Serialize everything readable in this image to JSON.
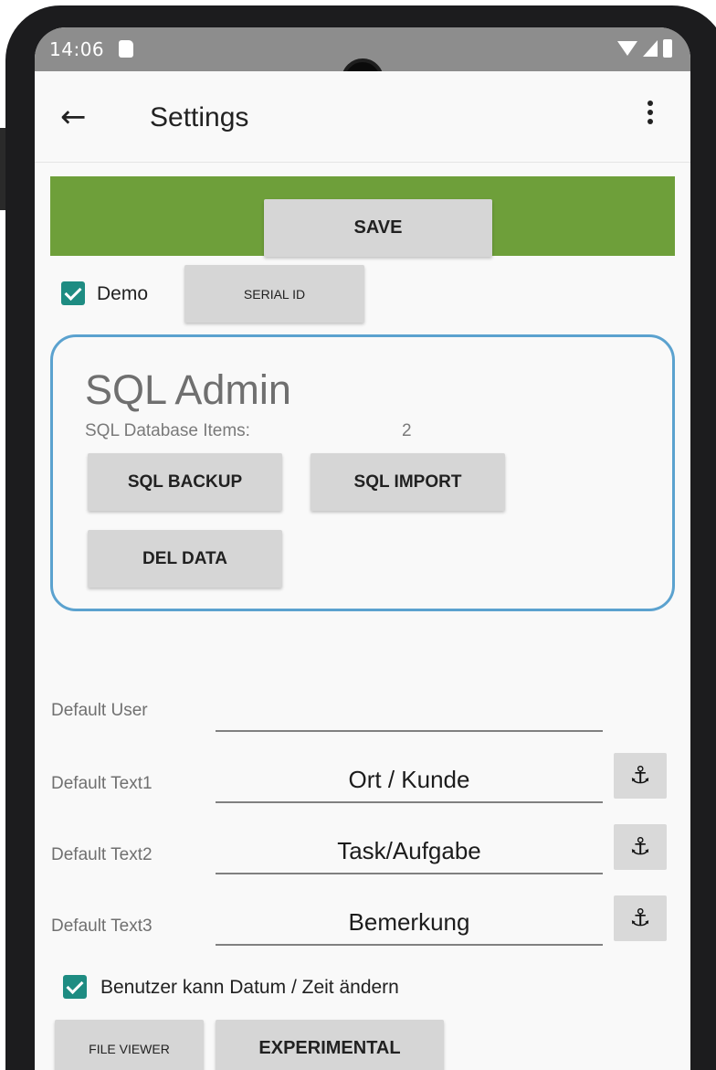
{
  "status_bar": {
    "time": "14:06"
  },
  "app_bar": {
    "title": "Settings"
  },
  "save_button": {
    "label": "SAVE"
  },
  "demo": {
    "label": "Demo",
    "checked": true
  },
  "serial_id_button": {
    "label": "SERIAL ID"
  },
  "sql_admin": {
    "title": "SQL Admin",
    "items_label": "SQL Database Items:",
    "items_count": "2",
    "backup_label": "SQL BACKUP",
    "import_label": "SQL IMPORT",
    "del_label": "DEL DATA"
  },
  "fields": [
    {
      "label": "Default User",
      "value": ""
    },
    {
      "label": "Default Text1",
      "value": "Ort / Kunde"
    },
    {
      "label": "Default Text2",
      "value": "Task/Aufgabe"
    },
    {
      "label": "Default Text3",
      "value": "Bemerkung"
    }
  ],
  "date_time_option": {
    "label": "Benutzer kann Datum / Zeit ändern",
    "checked": true
  },
  "file_viewer_button": {
    "label": "FILE VIEWER"
  },
  "experimental_button": {
    "label": "EXPERIMENTAL"
  },
  "colors": {
    "save_band": "#6e9f3a",
    "checkbox": "#1e8c82",
    "sql_border": "#5ba2cf"
  },
  "icons": {
    "back": "arrow-left-icon",
    "overflow": "more-vert-icon",
    "anchor": "anchor-icon"
  }
}
